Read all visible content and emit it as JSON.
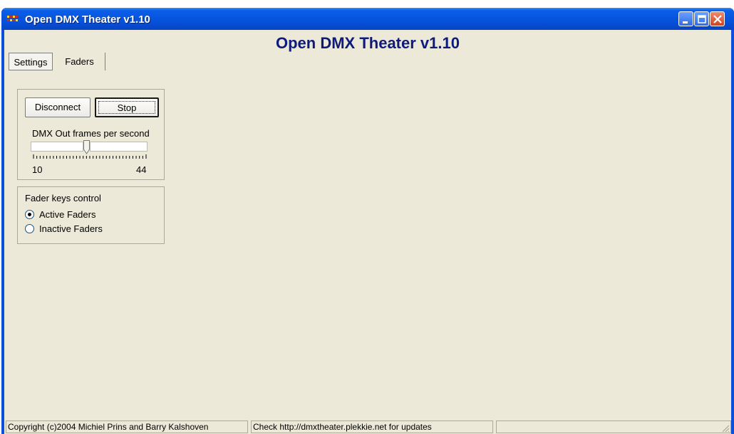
{
  "window": {
    "title": "Open DMX Theater v1.10",
    "controls": [
      "minimize-icon",
      "maximize-icon",
      "close-icon"
    ]
  },
  "main": {
    "heading": "Open DMX Theater v1.10"
  },
  "tabs": [
    {
      "label": "Settings",
      "selected": true
    },
    {
      "label": "Faders",
      "selected": false
    }
  ],
  "settings": {
    "disconnect_label": "Disconnect",
    "stop_label": "Stop",
    "fps_label": "DMX Out frames per second",
    "fps_slider": {
      "min": 10,
      "max": 44,
      "value_fraction": 0.48
    },
    "min_label": "10",
    "max_label": "44"
  },
  "fader_keys": {
    "title": "Fader keys control",
    "options": [
      {
        "label": "Active Faders",
        "checked": true
      },
      {
        "label": "Inactive Faders",
        "checked": false
      }
    ]
  },
  "statusbar": {
    "copyright": "Copyright (c)2004 Michiel Prins and Barry Kalshoven",
    "update": "Check http://dmxtheater.plekkie.net for updates",
    "third": ""
  },
  "colors": {
    "titlebar": "#0652dc",
    "heading": "#0e1a7c",
    "client": "#ece9d8"
  }
}
